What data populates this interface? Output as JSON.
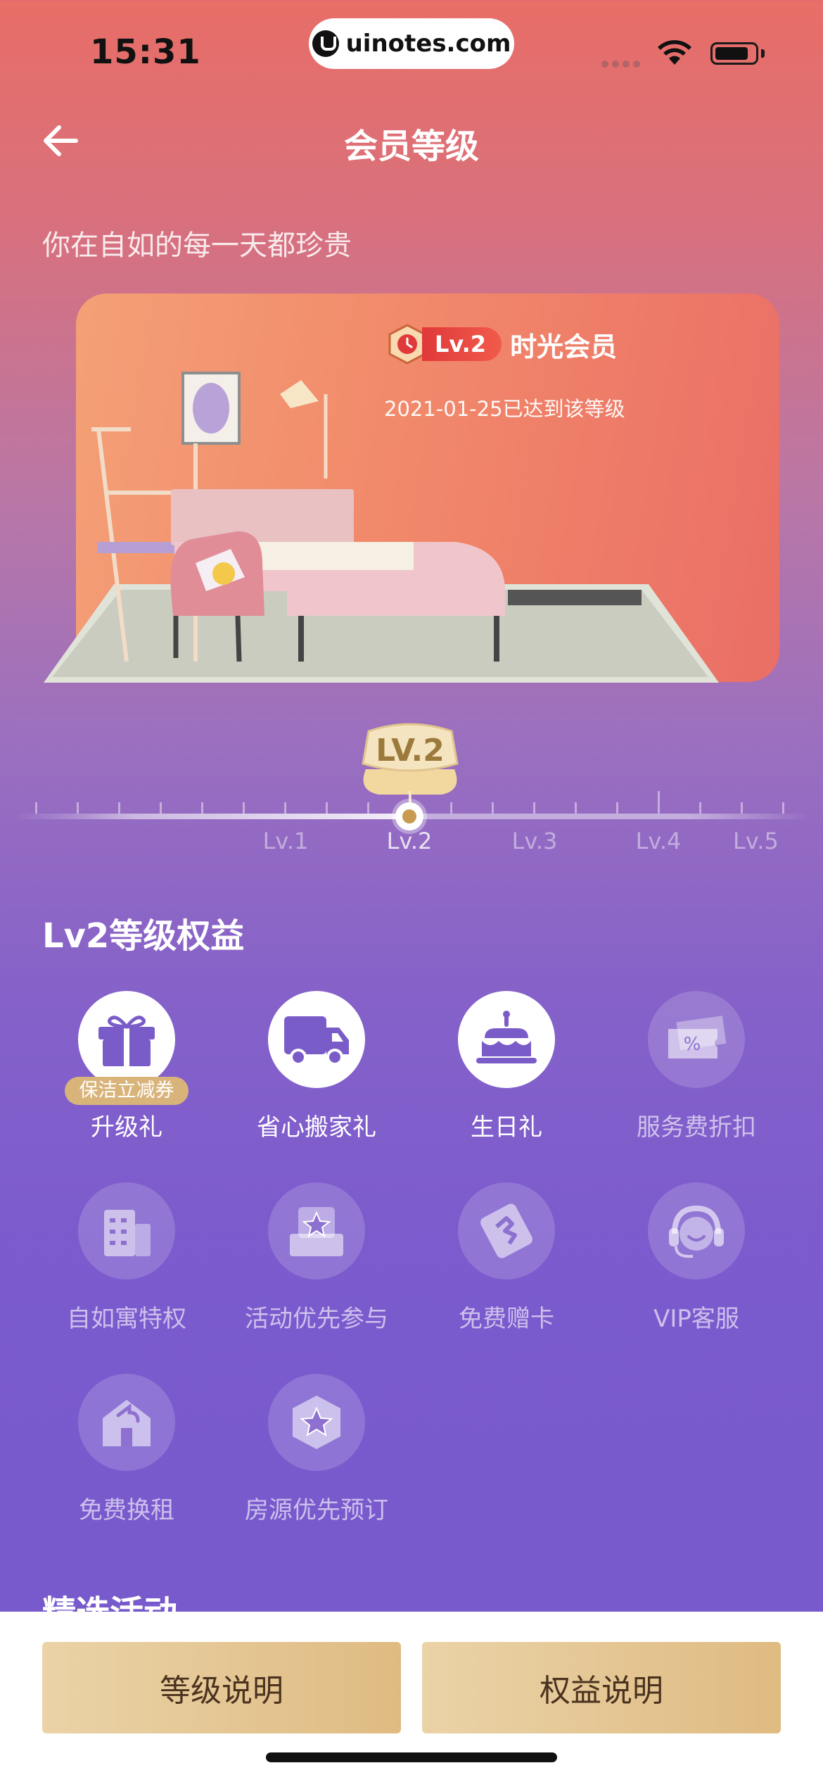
{
  "status_bar": {
    "time": "15:31",
    "url": "uinotes.com"
  },
  "nav": {
    "title": "会员等级"
  },
  "tagline": "你在自如的每一天都珍贵",
  "member_card": {
    "level_badge": "Lv.2",
    "level_name": "时光会员",
    "achieved_text": "2021-01-25已达到该等级"
  },
  "level_track": {
    "current_badge": "LV.2",
    "labels": [
      "Lv.1",
      "Lv.2",
      "Lv.3",
      "Lv.4",
      "Lv.5"
    ],
    "current_index": 1
  },
  "benefits": {
    "title": "Lv2等级权益",
    "items": [
      {
        "label": "升级礼",
        "icon": "gift-icon",
        "active": true,
        "tag": "保洁立减券"
      },
      {
        "label": "省心搬家礼",
        "icon": "truck-icon",
        "active": true
      },
      {
        "label": "生日礼",
        "icon": "cake-icon",
        "active": true
      },
      {
        "label": "服务费折扣",
        "icon": "discount-ticket-icon",
        "active": false
      },
      {
        "label": "自如寓特权",
        "icon": "building-icon",
        "active": false
      },
      {
        "label": "活动优先参与",
        "icon": "star-box-icon",
        "active": false
      },
      {
        "label": "免费赠卡",
        "icon": "card-icon",
        "active": false
      },
      {
        "label": "VIP客服",
        "icon": "headset-icon",
        "active": false
      },
      {
        "label": "免费换租",
        "icon": "house-swap-icon",
        "active": false
      },
      {
        "label": "房源优先预订",
        "icon": "star-hexagon-icon",
        "active": false
      }
    ]
  },
  "featured_title": "精选活动",
  "bottom_buttons": {
    "level_info": "等级说明",
    "benefit_info": "权益说明"
  },
  "colors": {
    "accent_gold": "#dfbb82",
    "active_icon": "#7a5cc9",
    "badge_red": "#e0393a"
  }
}
